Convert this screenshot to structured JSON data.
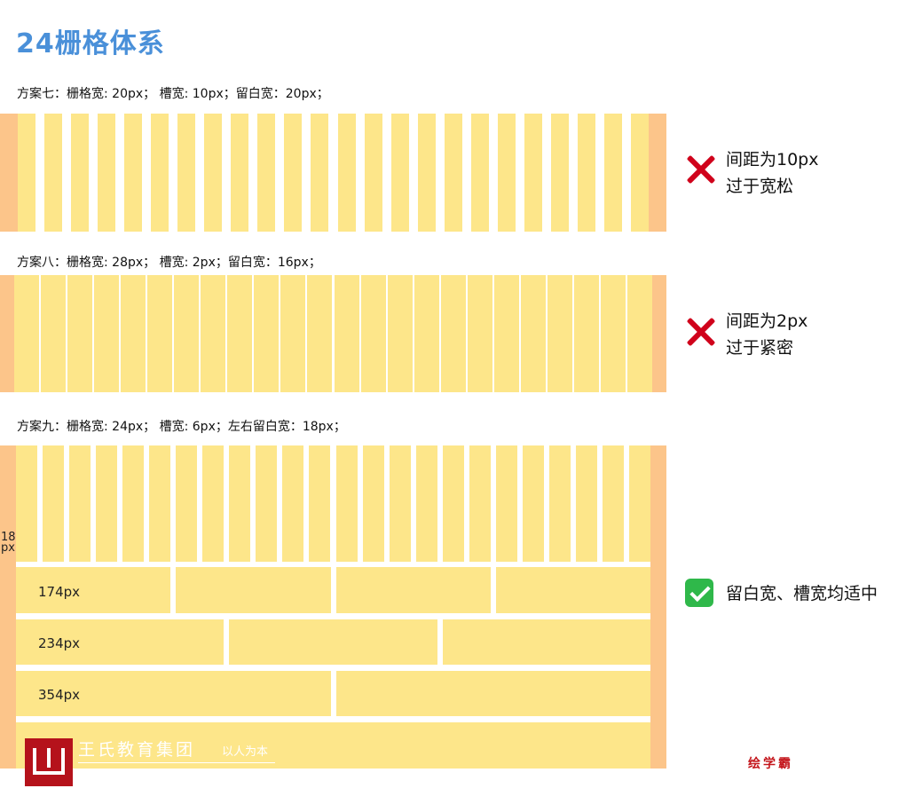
{
  "page": {
    "title": "24栅格体系",
    "colors": {
      "title": "#4a90d9",
      "margin": "#fcc58a",
      "column": "#fde68a",
      "cross": "#d0021b",
      "check": "#2fb84a"
    }
  },
  "scheme7": {
    "caption": "方案七：栅格宽: 20px；  槽宽: 10px；留白宽：20px；",
    "note_line1": "间距为10px",
    "note_line2": "过于宽松",
    "icon": "cross-icon"
  },
  "scheme8": {
    "caption": "方案八：栅格宽: 28px；  槽宽: 2px；留白宽：16px；",
    "note_line1": "间距为2px",
    "note_line2": "过于紧密",
    "icon": "cross-icon"
  },
  "scheme9": {
    "caption": "方案九：栅格宽: 24px；  槽宽: 6px；左右留白宽：18px；",
    "side_line1": "18",
    "side_line2": "px",
    "labels": [
      "174px",
      "234px",
      "354px"
    ],
    "note": "留白宽、槽宽均适中",
    "icon": "check-icon"
  },
  "footer": {
    "brand": "王氏教育集团",
    "slogan": "以人为本",
    "watermark": "绘学霸"
  }
}
